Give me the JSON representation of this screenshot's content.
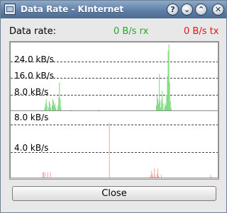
{
  "window": {
    "title": "Data Rate - KInternet",
    "app_icon": "kinternet-app-icon",
    "title_buttons": [
      {
        "name": "help-button",
        "glyph": "?"
      },
      {
        "name": "minimize-button",
        "glyph": "⌄"
      },
      {
        "name": "maximize-button",
        "glyph": "⌃"
      },
      {
        "name": "close-window-button",
        "glyph": "✕"
      }
    ]
  },
  "data_rate": {
    "label": "Data rate:",
    "rx": "0 B/s rx",
    "tx": "0 B/s tx"
  },
  "colors": {
    "rx": "#1fae1f",
    "tx": "#e01414",
    "rx_bars": "#7ddb7d",
    "tx_bars": "#f2a5a5"
  },
  "chart_data": [
    {
      "type": "bar",
      "series": "rx",
      "ylim": [
        0,
        33
      ],
      "gridlines": [
        24,
        16,
        8
      ],
      "tick_labels": [
        "24.0 kB/s",
        "16.0 kB/s",
        "8.0 kB/s"
      ],
      "values": [
        0,
        0,
        0,
        0,
        0,
        0,
        0,
        0,
        0,
        0,
        0,
        0,
        0,
        0,
        0,
        0,
        0,
        0,
        0,
        0,
        0,
        0,
        0,
        0,
        0,
        0,
        0,
        0,
        0,
        0,
        0,
        0,
        0,
        0,
        0,
        0,
        0,
        0,
        0,
        0,
        0,
        0,
        0,
        0,
        0,
        0,
        2,
        4,
        6,
        3,
        0,
        2,
        5,
        4,
        2,
        0,
        3,
        6,
        5,
        3,
        4,
        2,
        0,
        1,
        3,
        7,
        14,
        6,
        2,
        0,
        0,
        0,
        0,
        0,
        0,
        0,
        0,
        0,
        0,
        0,
        0,
        1,
        0,
        0,
        0,
        0,
        0,
        0,
        0,
        0,
        0,
        0,
        0,
        0,
        0,
        0,
        0,
        0,
        0,
        0,
        0,
        0,
        0,
        0,
        0,
        0,
        0,
        0,
        0,
        0,
        0,
        0,
        0,
        0,
        0,
        0,
        0,
        0,
        0,
        0,
        1,
        0,
        0,
        0,
        0,
        0,
        0,
        0,
        0,
        0,
        0,
        0,
        0,
        0,
        0,
        0,
        0,
        0,
        0,
        0,
        0,
        0,
        0,
        0,
        0,
        0,
        0,
        0,
        0,
        0,
        0,
        0,
        0,
        0,
        0,
        0,
        0,
        0,
        0,
        0,
        0,
        0,
        0,
        0,
        0,
        0,
        0,
        0,
        0,
        0,
        0,
        0,
        0,
        0,
        0,
        0,
        0,
        0,
        0,
        0,
        0,
        0,
        0,
        0,
        0,
        0,
        0,
        0,
        0,
        0,
        0,
        0,
        0,
        0,
        0,
        0,
        0,
        0,
        3,
        8,
        6,
        4,
        18,
        5,
        2,
        6,
        10,
        4,
        0,
        2,
        4,
        3,
        8,
        17,
        29,
        32,
        14,
        5,
        2,
        0,
        0,
        0,
        0,
        0,
        0,
        0,
        0,
        0,
        0,
        0,
        0,
        0,
        0,
        0,
        0,
        0,
        0,
        0,
        0,
        0,
        0,
        0,
        0,
        0,
        0,
        0,
        0,
        0,
        0,
        0,
        0,
        0,
        0,
        0,
        0,
        0,
        0,
        0,
        0,
        0,
        0,
        0,
        0,
        0,
        0,
        0,
        0,
        0,
        0,
        0,
        0,
        0,
        0,
        0,
        0,
        0,
        0,
        0,
        0,
        0,
        0,
        0,
        0,
        0
      ]
    },
    {
      "type": "bar",
      "series": "tx",
      "ylim": [
        0,
        10
      ],
      "gridlines": [
        8,
        4
      ],
      "tick_labels": [
        "8.0 kB/s",
        "4.0 kB/s"
      ],
      "values": [
        0,
        0,
        0,
        0,
        0,
        0,
        0,
        0,
        0,
        0,
        0,
        0,
        0,
        0,
        0,
        0,
        0,
        0,
        0,
        0,
        0,
        0,
        0,
        0,
        0,
        0,
        0,
        0,
        0,
        0,
        0,
        0,
        0,
        0,
        0,
        0,
        0,
        0,
        0,
        0,
        0,
        0,
        0,
        0,
        0,
        0,
        1,
        1,
        0,
        1,
        0,
        0,
        0,
        1,
        0,
        0,
        0,
        1,
        0,
        0,
        0,
        0,
        0,
        0,
        0,
        0,
        0,
        0,
        0,
        0,
        0,
        0,
        0,
        0,
        0,
        0,
        0,
        0,
        0,
        0,
        0,
        0,
        0,
        0,
        0,
        0,
        0,
        0,
        0,
        0,
        0,
        0,
        0,
        0,
        0,
        0,
        0,
        0,
        0,
        0,
        0,
        0,
        0,
        0,
        0,
        0,
        0,
        0,
        0,
        0,
        0,
        0,
        0,
        0,
        0,
        0,
        0,
        0,
        0,
        0,
        0,
        0,
        0,
        0,
        0,
        0,
        0,
        0,
        0,
        0,
        0,
        0,
        0,
        0,
        0,
        0,
        0,
        0,
        0,
        0,
        0,
        0,
        8.3,
        0,
        0,
        0,
        0,
        0,
        0,
        0,
        0,
        0,
        0,
        0,
        0,
        0,
        0,
        0,
        0,
        0,
        0,
        0,
        0,
        0,
        0,
        0,
        0,
        0,
        0,
        0,
        0,
        0,
        0,
        0,
        0,
        0,
        0,
        0,
        0,
        0,
        0,
        0,
        0,
        0,
        0,
        0,
        0,
        0,
        0,
        0,
        0,
        0,
        0,
        0,
        0,
        0,
        0,
        0,
        0,
        0,
        0.3,
        0,
        0.6,
        1.2,
        0.8,
        0.4,
        0,
        1.6,
        0.6,
        0,
        0.3,
        0.8,
        1.5,
        0.5,
        0.2,
        0,
        0,
        0.6,
        0,
        0,
        0,
        0,
        0,
        0,
        0,
        0,
        0,
        0,
        0,
        0,
        0,
        0,
        0,
        0,
        0,
        0,
        0,
        0,
        0,
        0,
        0,
        0,
        0,
        0,
        0,
        0,
        0,
        0,
        0,
        0,
        0,
        0,
        0,
        0,
        0,
        0,
        0,
        0,
        0,
        0,
        0,
        0,
        0,
        0,
        0,
        0,
        0,
        0,
        0,
        0,
        0,
        0,
        0,
        0,
        0,
        0,
        0,
        0,
        0,
        0,
        0,
        0,
        0,
        0,
        0,
        0,
        0,
        0,
        0.6,
        0,
        0.3,
        0.2,
        0,
        0,
        0,
        0,
        0,
        0,
        0,
        0,
        0
      ]
    }
  ],
  "footer": {
    "close_label": "Close"
  }
}
